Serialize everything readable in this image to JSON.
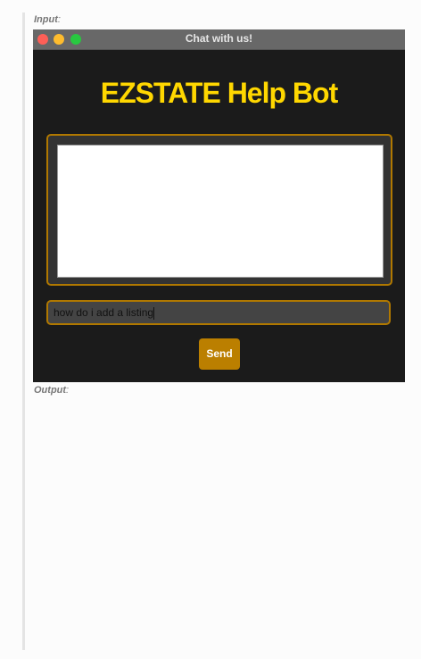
{
  "labels": {
    "input": "Input",
    "output": "Output",
    "colon": ":"
  },
  "window": {
    "title": "Chat with us!",
    "controls": {
      "close": "#fe5f57",
      "minimize": "#febc2e",
      "maximize": "#28c840"
    }
  },
  "app": {
    "heading": "EZSTATE Help Bot",
    "chat_log": "",
    "message_input": "how do i add a listing",
    "send_label": "Send",
    "accent": "#b07800",
    "heading_color": "#ffd700"
  }
}
